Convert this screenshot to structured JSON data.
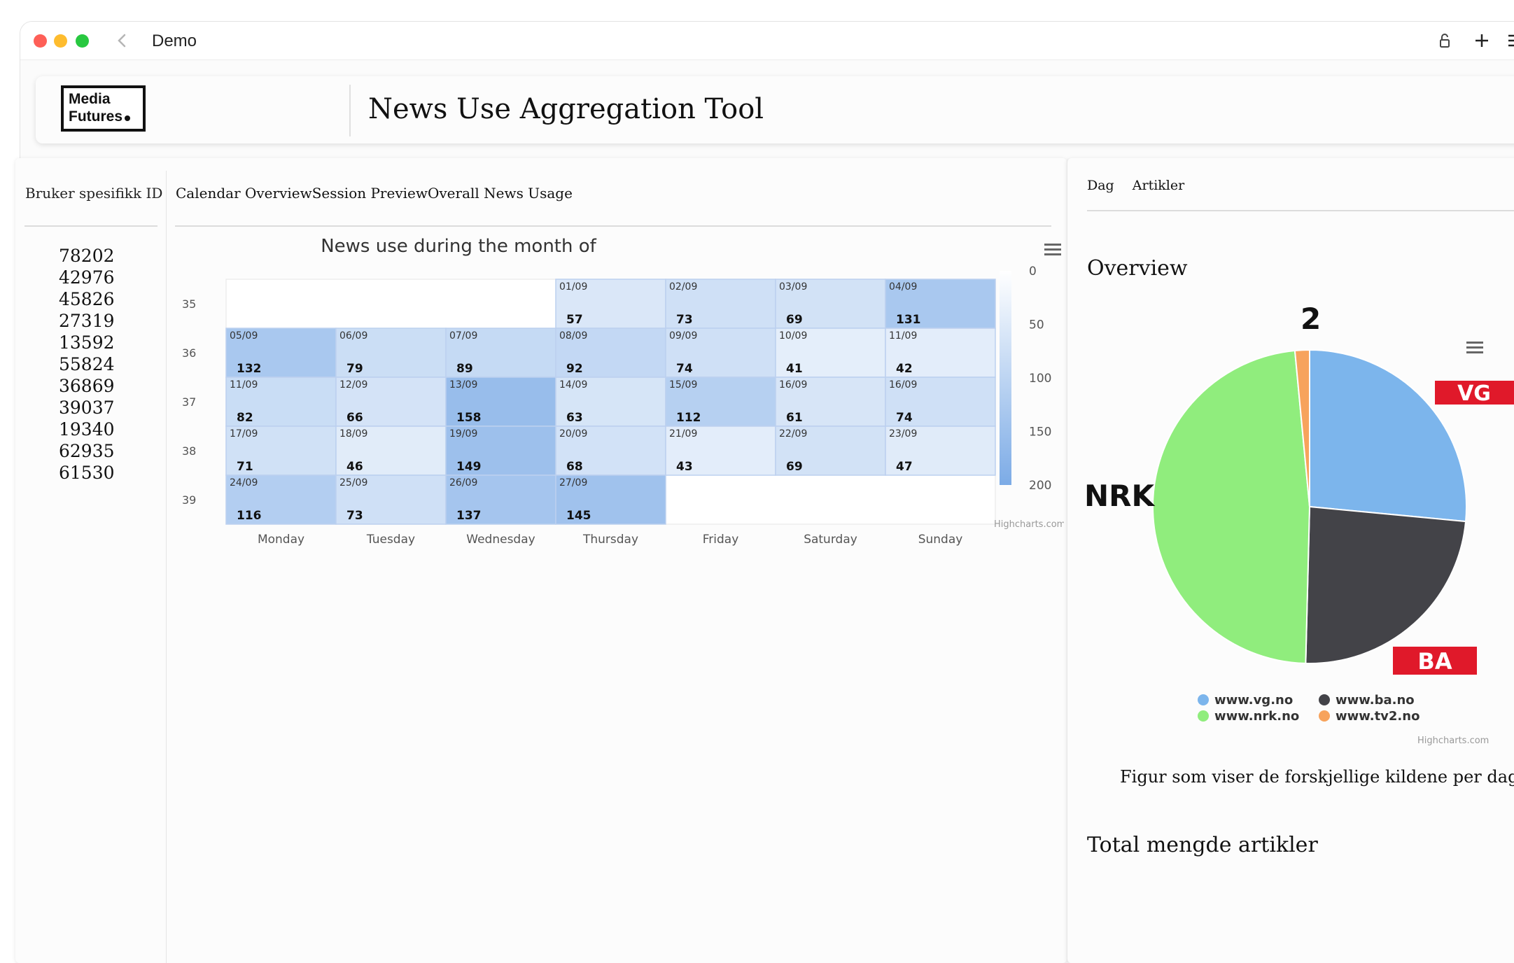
{
  "window": {
    "title": "Demo"
  },
  "header": {
    "logo_line1": "Media",
    "logo_line2": "Futures",
    "title": "News Use Aggregation Tool"
  },
  "sidebar": {
    "heading": "Bruker spesifikk ID",
    "ids": [
      "78202",
      "42976",
      "45826",
      "27319",
      "13592",
      "55824",
      "36869",
      "39037",
      "19340",
      "62935",
      "61530"
    ]
  },
  "main": {
    "tabs": [
      "Calendar Overview",
      "Session Preview",
      "Overall News Usage"
    ]
  },
  "right": {
    "tabs": [
      "Dag",
      "Artikler"
    ],
    "overview_heading": "Overview",
    "caption": "Figur som viser de forskjellige kildene per dag",
    "total_heading": "Total mengde artikler"
  },
  "chart_data": [
    {
      "type": "heatmap",
      "title": "News use during the month of",
      "weekdays": [
        "Monday",
        "Tuesday",
        "Wednesday",
        "Thursday",
        "Friday",
        "Saturday",
        "Sunday"
      ],
      "weeks": [
        "35",
        "36",
        "37",
        "38",
        "39"
      ],
      "colorAxis": {
        "min": 0,
        "max": 200,
        "ticks": [
          "0",
          "50",
          "100",
          "150",
          "200"
        ],
        "minColor": "#ffffff",
        "maxColor": "#7cabe6"
      },
      "cells": [
        {
          "week": 0,
          "day": 3,
          "date": "01/09",
          "value": 57
        },
        {
          "week": 0,
          "day": 4,
          "date": "02/09",
          "value": 73
        },
        {
          "week": 0,
          "day": 5,
          "date": "03/09",
          "value": 69
        },
        {
          "week": 0,
          "day": 6,
          "date": "04/09",
          "value": 131
        },
        {
          "week": 1,
          "day": 0,
          "date": "05/09",
          "value": 132
        },
        {
          "week": 1,
          "day": 1,
          "date": "06/09",
          "value": 79
        },
        {
          "week": 1,
          "day": 2,
          "date": "07/09",
          "value": 89
        },
        {
          "week": 1,
          "day": 3,
          "date": "08/09",
          "value": 92
        },
        {
          "week": 1,
          "day": 4,
          "date": "09/09",
          "value": 74
        },
        {
          "week": 1,
          "day": 5,
          "date": "10/09",
          "value": 41
        },
        {
          "week": 1,
          "day": 6,
          "date": "11/09",
          "value": 42
        },
        {
          "week": 2,
          "day": 0,
          "date": "11/09",
          "value": 82
        },
        {
          "week": 2,
          "day": 1,
          "date": "12/09",
          "value": 66
        },
        {
          "week": 2,
          "day": 2,
          "date": "13/09",
          "value": 158
        },
        {
          "week": 2,
          "day": 3,
          "date": "14/09",
          "value": 63
        },
        {
          "week": 2,
          "day": 4,
          "date": "15/09",
          "value": 112
        },
        {
          "week": 2,
          "day": 5,
          "date": "16/09",
          "value": 61
        },
        {
          "week": 2,
          "day": 6,
          "date": "16/09",
          "value": 74
        },
        {
          "week": 3,
          "day": 0,
          "date": "17/09",
          "value": 71
        },
        {
          "week": 3,
          "day": 1,
          "date": "18/09",
          "value": 46
        },
        {
          "week": 3,
          "day": 2,
          "date": "19/09",
          "value": 149
        },
        {
          "week": 3,
          "day": 3,
          "date": "20/09",
          "value": 68
        },
        {
          "week": 3,
          "day": 4,
          "date": "21/09",
          "value": 43
        },
        {
          "week": 3,
          "day": 5,
          "date": "22/09",
          "value": 69
        },
        {
          "week": 3,
          "day": 6,
          "date": "23/09",
          "value": 47
        },
        {
          "week": 4,
          "day": 0,
          "date": "24/09",
          "value": 116
        },
        {
          "week": 4,
          "day": 1,
          "date": "25/09",
          "value": 73
        },
        {
          "week": 4,
          "day": 2,
          "date": "26/09",
          "value": 137
        },
        {
          "week": 4,
          "day": 3,
          "date": "27/09",
          "value": 145
        }
      ],
      "credit": "Highcharts.com"
    },
    {
      "type": "pie",
      "slices": [
        {
          "name": "www.vg.no",
          "share": 0.265,
          "color": "#7cb5ec",
          "logo": "VG"
        },
        {
          "name": "www.ba.no",
          "share": 0.239,
          "color": "#434348",
          "logo": "BA"
        },
        {
          "name": "www.nrk.no",
          "share": 0.481,
          "color": "#90ed7d",
          "logo": "NRK"
        },
        {
          "name": "www.tv2.no",
          "share": 0.015,
          "color": "#f7a35c",
          "logo": "2"
        }
      ],
      "credit": "Highcharts.com"
    }
  ]
}
